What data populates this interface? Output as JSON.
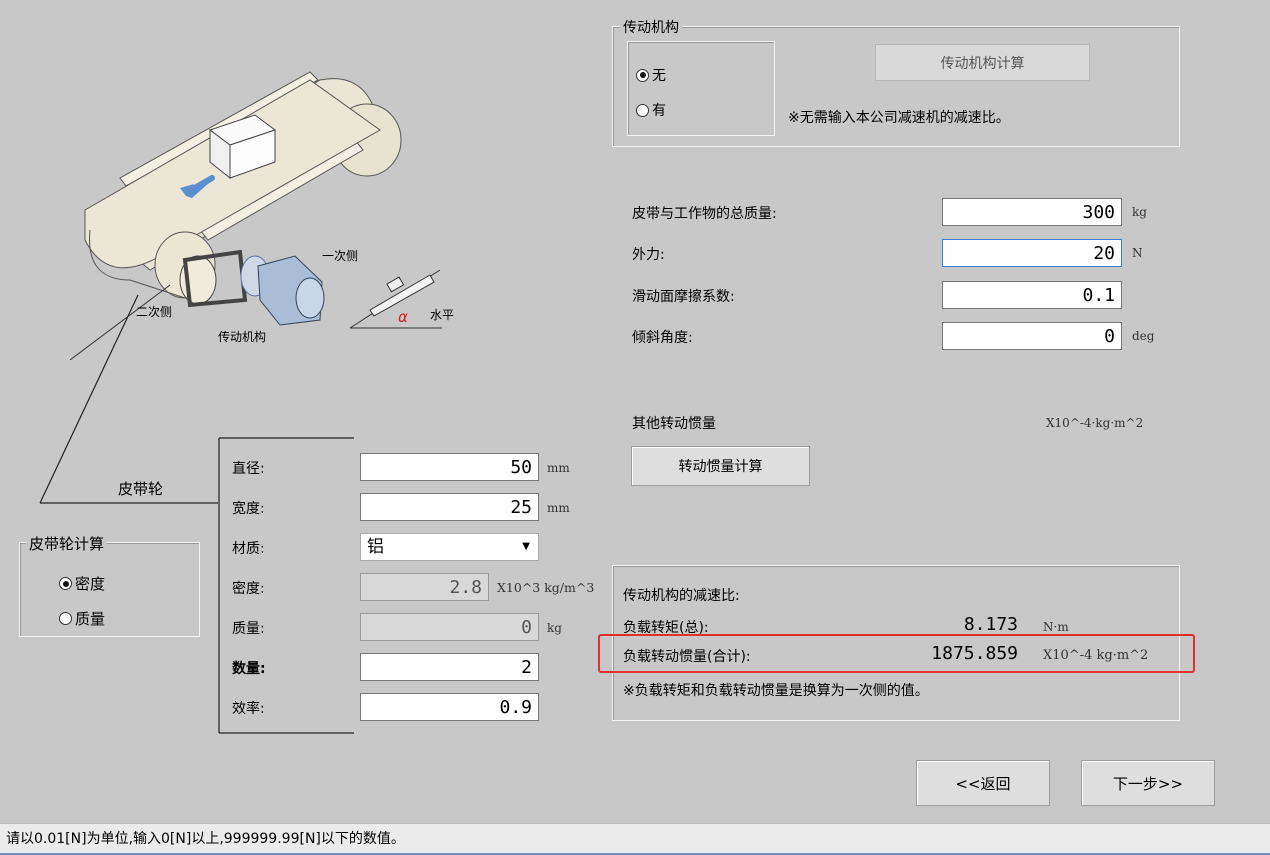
{
  "transmission": {
    "legend": "传动机构",
    "calc_button": "传动机构计算",
    "radio_none": "无",
    "radio_has": "有",
    "note": "※无需输入本公司减速机的减速比。"
  },
  "params": [
    {
      "label": "皮带与工作物的总质量:",
      "value": "300",
      "unit": "kg"
    },
    {
      "label": "外力:",
      "value": "20",
      "unit": "N"
    },
    {
      "label": "滑动面摩擦系数:",
      "value": "0.1",
      "unit": ""
    },
    {
      "label": "倾斜角度:",
      "value": "0",
      "unit": "deg"
    }
  ],
  "other_inertia": {
    "label": "其他转动惯量",
    "unit": "X10^-4·kg·m^2",
    "button": "转动惯量计算"
  },
  "illustration": {
    "primary_side": "一次侧",
    "secondary_side": "二次侧",
    "transmission": "传动机构",
    "horizontal": "水平",
    "alpha": "α"
  },
  "pulley": {
    "label": "皮带轮",
    "rows": [
      {
        "label": "直径:",
        "value": "50",
        "unit": "mm"
      },
      {
        "label": "宽度:",
        "value": "25",
        "unit": "mm"
      },
      {
        "label": "材质:",
        "value": "铝",
        "unit": ""
      },
      {
        "label": "密度:",
        "value": "2.8",
        "unit": "X10^3 kg/m^3"
      },
      {
        "label": "质量:",
        "value": "0",
        "unit": "kg"
      },
      {
        "label": "数量:",
        "value": "2",
        "unit": ""
      },
      {
        "label": "效率:",
        "value": "0.9",
        "unit": ""
      }
    ]
  },
  "pulley_calc": {
    "legend": "皮带轮计算",
    "radio_density": "密度",
    "radio_mass": "质量"
  },
  "results": {
    "ratio_label": "传动机构的减速比:",
    "torque_label": "负载转矩(总):",
    "torque_value": "8.173",
    "torque_unit": "N·m",
    "inertia_label": "负载转动惯量(合计):",
    "inertia_value": "1875.859",
    "inertia_unit": "X10^-4 kg·m^2",
    "note": "※负载转矩和负载转动惯量是换算为一次侧的值。"
  },
  "nav": {
    "back": "<<返回",
    "next": "下一步>>"
  },
  "status": "请以0.01[N]为单位,输入0[N]以上,999999.99[N]以下的数值。",
  "colors": {
    "background": "#c8c8c8",
    "highlight": "#e03030",
    "focus": "#3c7fd6"
  }
}
